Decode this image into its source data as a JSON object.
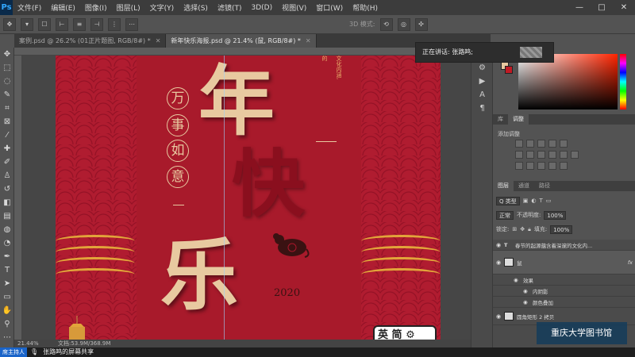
{
  "app": {
    "logo": "Ps",
    "menu": [
      "文件(F)",
      "编辑(E)",
      "图像(I)",
      "图层(L)",
      "文字(Y)",
      "选择(S)",
      "滤镜(T)",
      "3D(D)",
      "视图(V)",
      "窗口(W)",
      "帮助(H)"
    ],
    "window_controls": [
      "—",
      "□",
      "✕"
    ]
  },
  "options_bar": {
    "mode_label": "3D 模式:"
  },
  "tabs": [
    {
      "label": "案例.psd @ 26.2% (01正片题图, RGB/8#) *",
      "active": false
    },
    {
      "label": "新年快乐海报.psd @ 21.4% (鼠, RGB/8#) *",
      "active": true
    }
  ],
  "poster": {
    "big_chars": [
      "年",
      "快",
      "乐"
    ],
    "circle_chars": [
      "万",
      "事",
      "如",
      "意"
    ],
    "vertical_text": "文化内涵,",
    "vertical_text_2": "的",
    "year": "2020"
  },
  "ime": {
    "label": "英 简"
  },
  "status": {
    "zoom": "21.44%",
    "doc": "文档:53.9M/368.9M"
  },
  "speak_popup": {
    "text": "正在讲话: 张路鸣;"
  },
  "panels": {
    "tabs_top": [
      "库",
      "调整"
    ],
    "adjust_label": "添加调整",
    "layer_tabs": [
      "图层",
      "通道",
      "路径"
    ],
    "kind_label": "Q 类型",
    "blend_mode": "正常",
    "opacity_label": "不透明度:",
    "opacity_value": "100%",
    "lock_label": "锁定:",
    "fill_label": "填充:",
    "fill_value": "100%",
    "layers": [
      {
        "name": "春节的起源蕴含着深邃的文化内...",
        "type": "text"
      },
      {
        "name": "鼠",
        "type": "image",
        "fx": "fx"
      },
      {
        "name": "效果",
        "type": "effect"
      },
      {
        "name": "内阴影",
        "type": "effect"
      },
      {
        "name": "颜色叠加",
        "type": "effect"
      },
      {
        "name": "圆角矩形 2 拷贝",
        "type": "image"
      }
    ]
  },
  "watermark": {
    "text": "重庆大学图书馆"
  },
  "taskbar": {
    "host_label": "席主持人",
    "share_text": "张路鸣的屏幕共享"
  },
  "colors": {
    "poster_red": "#a8162a",
    "gold": "#e8c9a0",
    "accent_gold": "#e2a43a"
  }
}
